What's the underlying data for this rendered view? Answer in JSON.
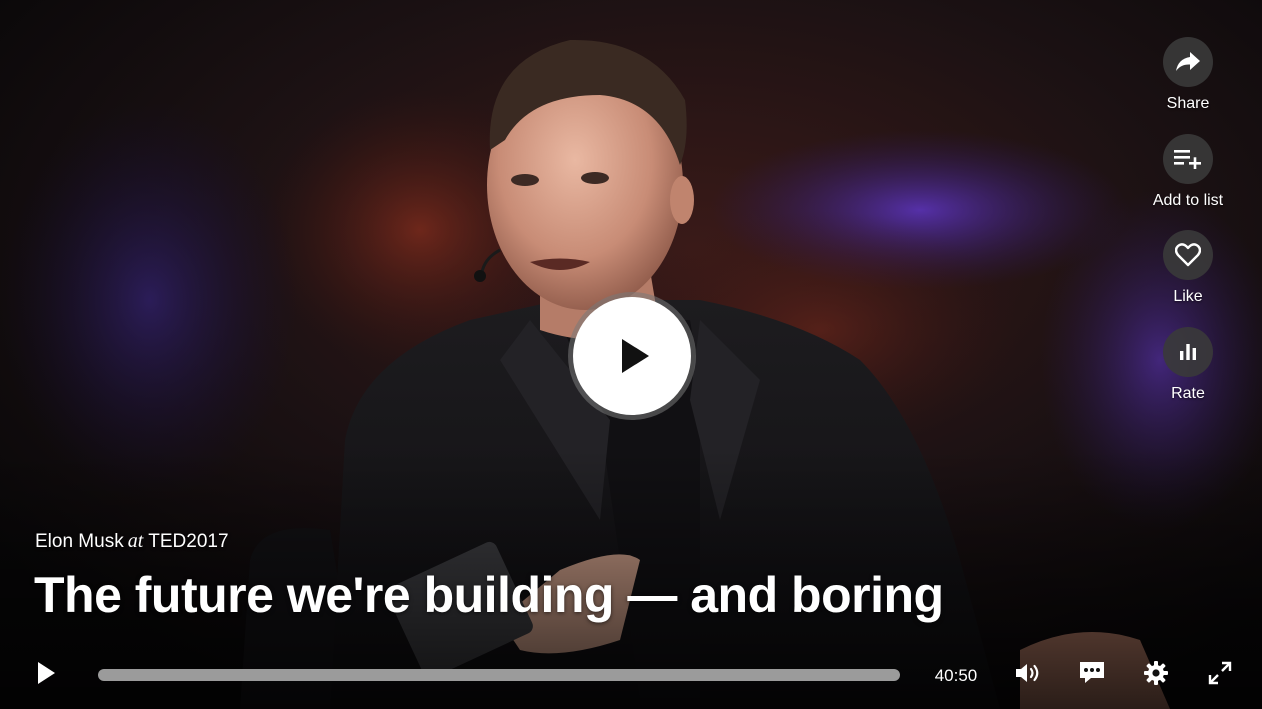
{
  "video": {
    "speaker": "Elon Musk",
    "at_word": "at",
    "event": "TED2017",
    "title": "The future we're building — and boring",
    "duration": "40:50",
    "progress": 0
  },
  "actions": [
    {
      "label": "Share",
      "icon": "share-icon"
    },
    {
      "label": "Add to list",
      "icon": "playlist-add-icon"
    },
    {
      "label": "Like",
      "icon": "heart-icon"
    },
    {
      "label": "Rate",
      "icon": "bar-chart-icon"
    }
  ],
  "controls": {
    "play": "play-icon",
    "volume": "volume-icon",
    "captions": "captions-icon",
    "settings": "gear-icon",
    "fullscreen": "fullscreen-icon"
  },
  "colors": {
    "accent": "#e62b1e",
    "button_bg": "#3a3a3a",
    "track": "#9b9b9b"
  }
}
